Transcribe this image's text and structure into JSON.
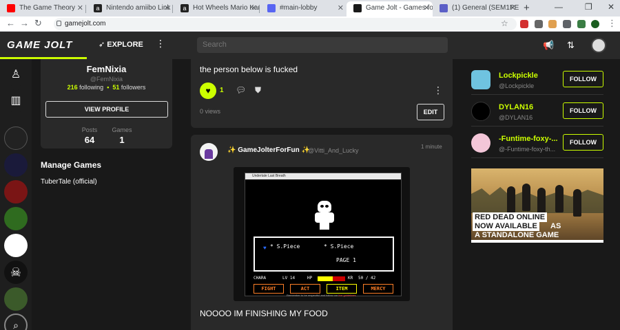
{
  "browser": {
    "tabs": [
      {
        "title": "The Game Theory",
        "color": "#ff0000",
        "closable": true
      },
      {
        "title": "Nintendo amiibo Link C",
        "color": "#222222",
        "closable": true
      },
      {
        "title": "Hot Wheels Mario Kart",
        "color": "#222222",
        "closable": true
      },
      {
        "title": "#main-lobby",
        "color": "#5865f2",
        "closable": true
      },
      {
        "title": "Game Jolt - Games for",
        "color": "#1a1a1a",
        "closable": true,
        "active": true
      },
      {
        "title": "(1) General (SEM1PER2",
        "color": "#5b5fc7",
        "closable": true
      }
    ],
    "new_tab": "+",
    "url": "gamejolt.com"
  },
  "header": {
    "logo": "GAME JOLT",
    "explore": "EXPLORE",
    "search_placeholder": "Search"
  },
  "profile": {
    "name": "FemNixia",
    "handle": "@FemNixia",
    "following": "216",
    "following_label": "following",
    "followers": "51",
    "followers_label": "followers",
    "view_profile": "VIEW PROFILE",
    "posts_label": "Posts",
    "posts": "64",
    "games_label": "Games",
    "games": "1"
  },
  "manage_games": {
    "title": "Manage Games",
    "items": [
      "TuberTale (official)"
    ]
  },
  "post1": {
    "text": "the person below is fucked",
    "likes": "1",
    "views": "0 views",
    "edit": "EDIT"
  },
  "post2": {
    "author": "GameJolterForFun",
    "handle": "@Vitti_And_Lucky",
    "time": "1 minute",
    "text": "NOOOO IM FINISHING MY FOOD",
    "game": {
      "window_title": "Undertale Last Breath",
      "option1": "S.Piece",
      "option2": "S.Piece",
      "page": "PAGE 1",
      "name": "CHARA",
      "lv": "LV 14",
      "hp_label": "HP",
      "kr": "KR",
      "hp": "50 / 42",
      "hp_fraction": 0.55,
      "buttons": [
        "FIGHT",
        "ACT",
        "ITEM",
        "MERCY"
      ],
      "footer": "Remember to be respectful and follow our",
      "footer_link": "live guidelines"
    }
  },
  "suggested": [
    {
      "name": "Lockpickle",
      "handle": "@Lockpickle",
      "follow": "FOLLOW",
      "avatar_color": "#6fc3e0"
    },
    {
      "name": "DYLAN16",
      "handle": "@DYLAN16",
      "follow": "FOLLOW",
      "avatar_color": "#000000"
    },
    {
      "name": "-Funtime-foxy-...",
      "handle": "@-Funtime-foxy-th...",
      "follow": "FOLLOW",
      "avatar_color": "#f3c6d8"
    }
  ],
  "ad": {
    "line1": "RED DEAD ONLINE",
    "line2": "NOW AVAILABLE",
    "line2b": "AS",
    "line3": "A STANDALONE GAME"
  },
  "rail_icons": [
    {
      "name": "rail-profile-icon",
      "color": "#1e1e1e"
    },
    {
      "name": "rail-library-icon",
      "color": "#1e1e1e"
    },
    {
      "name": "rail-community-dice",
      "color": "#222222"
    },
    {
      "name": "rail-community-space",
      "color": "#1a1a3a"
    },
    {
      "name": "rail-community-fnaf",
      "color": "#7a1515"
    },
    {
      "name": "rail-community-bendy",
      "color": "#2f6b1f"
    },
    {
      "name": "rail-community-stick",
      "color": "#ffffff"
    },
    {
      "name": "rail-community-sans",
      "color": "#111111"
    },
    {
      "name": "rail-community-amongus",
      "color": "#3b5a2a"
    },
    {
      "name": "rail-search-icon",
      "color": "#1e1e1e"
    }
  ]
}
